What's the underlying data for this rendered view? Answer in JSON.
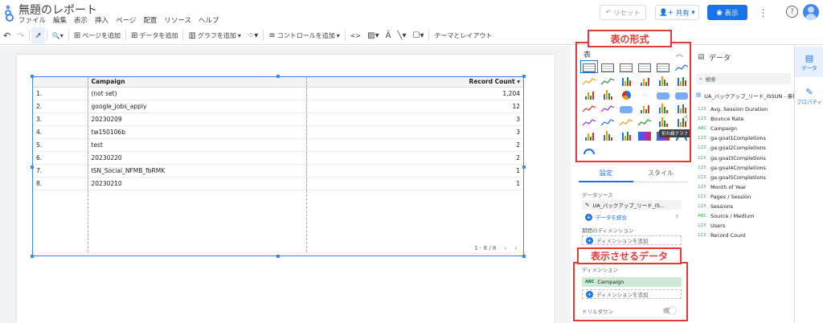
{
  "header": {
    "title": "無題のレポート",
    "menu": [
      "ファイル",
      "編集",
      "表示",
      "挿入",
      "ページ",
      "配置",
      "リソース",
      "ヘルプ"
    ],
    "reset_label": "リセット",
    "share_label": "共有",
    "view_label": "表示"
  },
  "toolbar": {
    "add_page": "ページを追加",
    "add_data": "データを追加",
    "add_chart": "グラフを追加",
    "add_control": "コントロールを追加",
    "theme_layout": "テーマとレイアウト"
  },
  "table": {
    "columns": [
      "Campaign",
      "Record Count"
    ],
    "sort_indicator": "▾",
    "rows": [
      {
        "index": "1.",
        "campaign": "(not set)",
        "count": "1,204"
      },
      {
        "index": "2.",
        "campaign": "google_jobs_apply",
        "count": "12"
      },
      {
        "index": "3.",
        "campaign": "20230209",
        "count": "3"
      },
      {
        "index": "4.",
        "campaign": "tw150106b",
        "count": "3"
      },
      {
        "index": "5.",
        "campaign": "test",
        "count": "2"
      },
      {
        "index": "6.",
        "campaign": "20230220",
        "count": "2"
      },
      {
        "index": "7.",
        "campaign": "ISN_Social_NFMB_fbRMK",
        "count": "1"
      },
      {
        "index": "8.",
        "campaign": "20230210",
        "count": "1"
      }
    ],
    "pager": "1 - 8 / 8"
  },
  "chart_panel": {
    "title": "表",
    "tooltip": "折れ線グラフ"
  },
  "setup": {
    "tab_setup": "設定",
    "tab_style": "スタイル",
    "datasource_label": "データソース",
    "datasource_value": "UA_バックアップ_リード_IS...",
    "merge_data": "データを統合",
    "period_dimension": "期間のディメンション",
    "add_dimension": "ディメンションを追加",
    "dimension_label": "ディメンション",
    "dimension_value": "Campaign",
    "dimension_type": "ABC",
    "drilldown": "ドリルダウン"
  },
  "data_panel": {
    "title": "データ",
    "search_placeholder": "検索",
    "source": "UA_バックアップ_リード_ISSUN - 参照...",
    "fields": [
      {
        "type": "123",
        "name": "Avg. Session Duration"
      },
      {
        "type": "123",
        "name": "Bounce Rate"
      },
      {
        "type": "ABC",
        "name": "Campaign"
      },
      {
        "type": "123",
        "name": "ga:goal1Completions"
      },
      {
        "type": "123",
        "name": "ga:goal2Completions"
      },
      {
        "type": "123",
        "name": "ga:goal3Completions"
      },
      {
        "type": "123",
        "name": "ga:goal4Completions"
      },
      {
        "type": "123",
        "name": "ga:goal5Completions"
      },
      {
        "type": "123",
        "name": "Month of Year"
      },
      {
        "type": "123",
        "name": "Pages / Session"
      },
      {
        "type": "123",
        "name": "Sessions"
      },
      {
        "type": "ABC",
        "name": "Source / Medium"
      },
      {
        "type": "123",
        "name": "Users"
      },
      {
        "type": "123",
        "name": "Record Count"
      }
    ]
  },
  "rail": {
    "data": "データ",
    "properties": "プロパティ"
  },
  "annotations": {
    "chart_type": "表の形式",
    "display_data": "表示させるデータ"
  },
  "colors": {
    "accent": "#1a73e8",
    "annotation": "#e53935",
    "selection": "#4285f4"
  }
}
